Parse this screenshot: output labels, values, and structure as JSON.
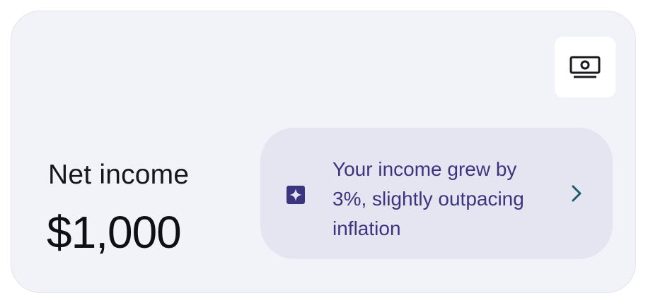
{
  "card": {
    "title": "Net income",
    "amount": "$1,000",
    "corner_icon": "money-bill-icon"
  },
  "insight": {
    "icon": "sparkle-icon",
    "text": "Your income grew by 3%, slightly outpacing inflation",
    "chevron_icon": "chevron-right-icon"
  },
  "colors": {
    "card_background": "#f2f2f9",
    "insight_background": "#e5e5f1",
    "insight_text": "#3b3580",
    "sparkle": "#3b3580",
    "chevron": "#1f5a6a"
  }
}
